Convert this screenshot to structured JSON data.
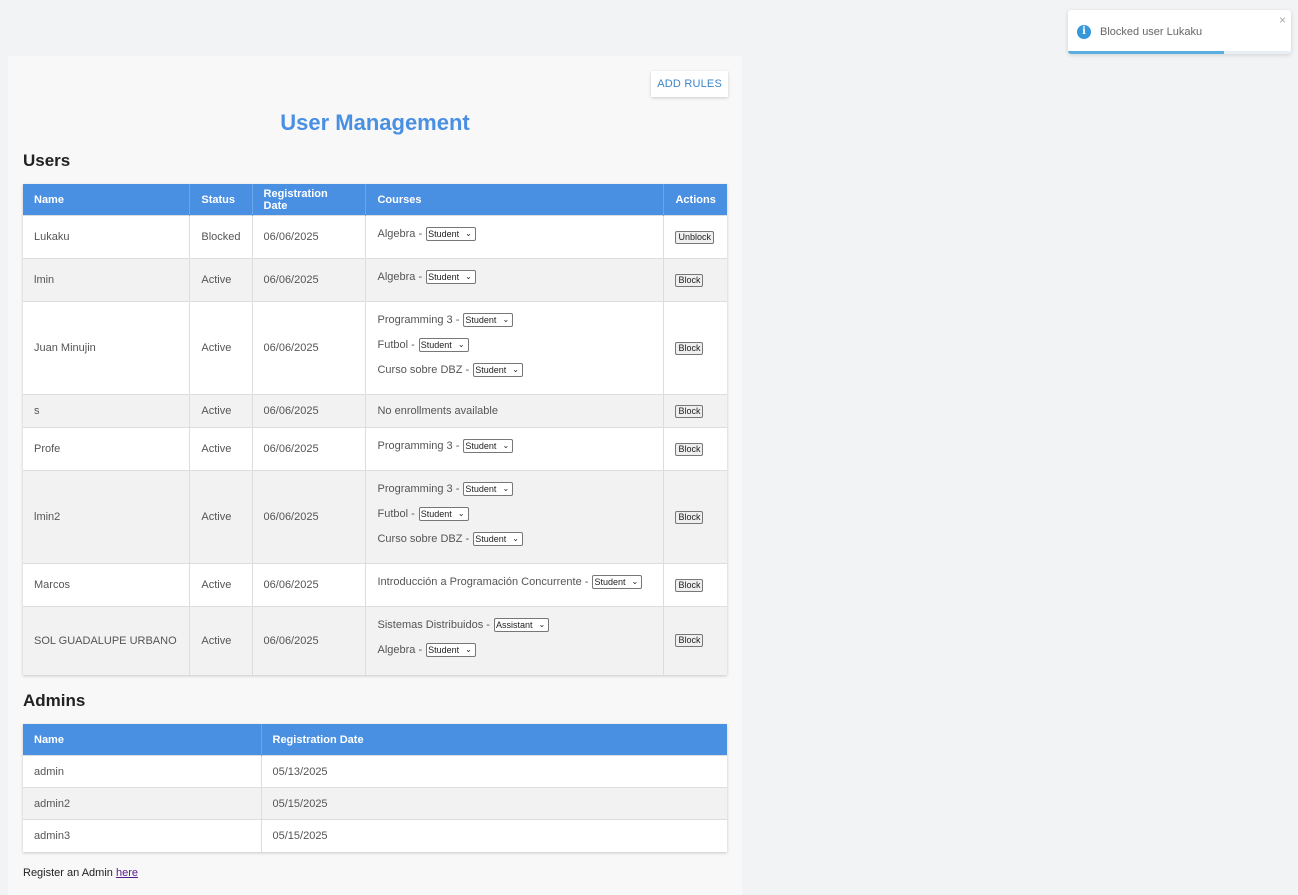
{
  "toast": {
    "message": "Blocked user Lukaku",
    "close_glyph": "×",
    "icon": "info-icon",
    "progress": 0.7
  },
  "header": {
    "add_rules_label": "ADD RULES",
    "title": "User Management"
  },
  "users": {
    "section_title": "Users",
    "columns": [
      "Name",
      "Status",
      "Registration Date",
      "Courses",
      "Actions"
    ],
    "rows": [
      {
        "name": "Lukaku",
        "status": "Blocked",
        "date": "06/06/2025",
        "courses": [
          {
            "label": "Algebra -",
            "role": "Student"
          }
        ],
        "action": "Unblock"
      },
      {
        "name": "lmin",
        "status": "Active",
        "date": "06/06/2025",
        "courses": [
          {
            "label": "Algebra -",
            "role": "Student"
          }
        ],
        "action": "Block"
      },
      {
        "name": "Juan Minujin",
        "status": "Active",
        "date": "06/06/2025",
        "courses": [
          {
            "label": "Programming 3 -",
            "role": "Student"
          },
          {
            "label": "Futbol -",
            "role": "Student"
          },
          {
            "label": "Curso sobre DBZ -",
            "role": "Student"
          }
        ],
        "action": "Block"
      },
      {
        "name": "s",
        "status": "Active",
        "date": "06/06/2025",
        "courses": [],
        "no_courses": "No enrollments available",
        "action": "Block"
      },
      {
        "name": "Profe",
        "status": "Active",
        "date": "06/06/2025",
        "courses": [
          {
            "label": "Programming 3 -",
            "role": "Student"
          }
        ],
        "action": "Block"
      },
      {
        "name": "lmin2",
        "status": "Active",
        "date": "06/06/2025",
        "courses": [
          {
            "label": "Programming 3 -",
            "role": "Student"
          },
          {
            "label": "Futbol -",
            "role": "Student"
          },
          {
            "label": "Curso sobre DBZ -",
            "role": "Student"
          }
        ],
        "action": "Block"
      },
      {
        "name": "Marcos",
        "status": "Active",
        "date": "06/06/2025",
        "courses": [
          {
            "label": "Introducción a Programación Concurrente -",
            "role": "Student"
          }
        ],
        "action": "Block"
      },
      {
        "name": "SOL GUADALUPE URBANO",
        "status": "Active",
        "date": "06/06/2025",
        "courses": [
          {
            "label": "Sistemas Distribuidos -",
            "role": "Assistant"
          },
          {
            "label": "Algebra -",
            "role": "Student"
          }
        ],
        "action": "Block"
      }
    ]
  },
  "admins": {
    "section_title": "Admins",
    "columns": [
      "Name",
      "Registration Date"
    ],
    "rows": [
      {
        "name": "admin",
        "date": "05/13/2025"
      },
      {
        "name": "admin2",
        "date": "05/15/2025"
      },
      {
        "name": "admin3",
        "date": "05/15/2025"
      }
    ]
  },
  "footer": {
    "text": "Register an Admin",
    "link_label": "here"
  }
}
